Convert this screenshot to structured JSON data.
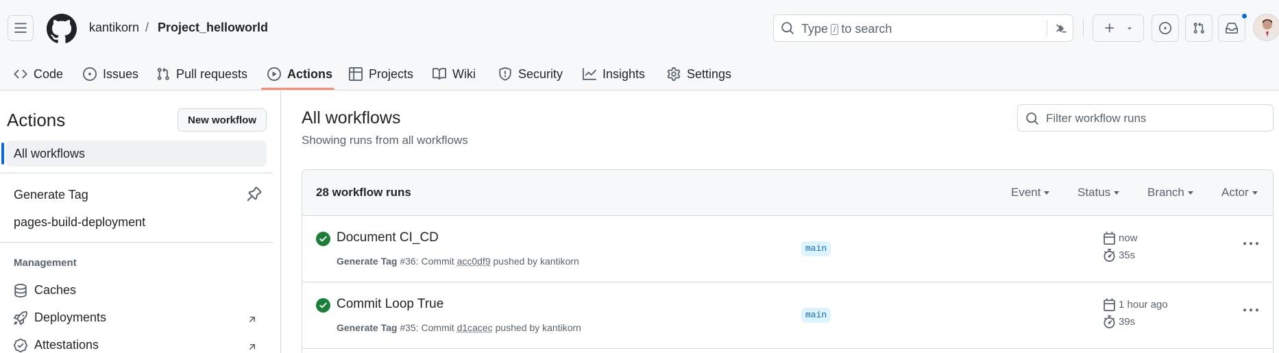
{
  "header": {
    "owner": "kantikorn",
    "separator": "/",
    "repo": "Project_helloworld",
    "search": {
      "prefix": "Type",
      "key": "/",
      "suffix": "to search"
    }
  },
  "repo_nav": [
    {
      "id": "code",
      "label": "Code",
      "icon": "code-icon"
    },
    {
      "id": "issues",
      "label": "Issues",
      "icon": "issue-opened-icon"
    },
    {
      "id": "pulls",
      "label": "Pull requests",
      "icon": "git-pull-request-icon"
    },
    {
      "id": "actions",
      "label": "Actions",
      "icon": "play-icon",
      "active": true
    },
    {
      "id": "projects",
      "label": "Projects",
      "icon": "table-icon"
    },
    {
      "id": "wiki",
      "label": "Wiki",
      "icon": "book-icon"
    },
    {
      "id": "security",
      "label": "Security",
      "icon": "shield-icon"
    },
    {
      "id": "insights",
      "label": "Insights",
      "icon": "graph-icon"
    },
    {
      "id": "settings",
      "label": "Settings",
      "icon": "gear-icon"
    }
  ],
  "sidebar": {
    "title": "Actions",
    "new_workflow": "New workflow",
    "all_workflows": "All workflows",
    "workflows": [
      "Generate Tag",
      "pages-build-deployment"
    ],
    "management_heading": "Management",
    "management": [
      {
        "label": "Caches",
        "icon": "database-icon"
      },
      {
        "label": "Deployments",
        "icon": "rocket-icon",
        "external": true
      },
      {
        "label": "Attestations",
        "icon": "verified-icon",
        "external": true
      }
    ]
  },
  "main": {
    "title": "All workflows",
    "subtitle": "Showing runs from all workflows",
    "filter_placeholder": "Filter workflow runs",
    "runs_count": "28 workflow runs",
    "filters": [
      "Event",
      "Status",
      "Branch",
      "Actor"
    ],
    "runs": [
      {
        "title": "Document CI_CD",
        "workflow": "Generate Tag",
        "detail_prefix": "#36: Commit",
        "sha": "acc0df9",
        "detail_suffix": "pushed by kantikorn",
        "branch": "main",
        "when": "now",
        "duration": "35s",
        "status": "success"
      },
      {
        "title": "Commit Loop True",
        "workflow": "Generate Tag",
        "detail_prefix": "#35: Commit",
        "sha": "d1cacec",
        "detail_suffix": "pushed by kantikorn",
        "branch": "main",
        "when": "1 hour ago",
        "duration": "39s",
        "status": "success"
      }
    ]
  },
  "colors": {
    "accent": "#0969da",
    "success": "#1a7f37",
    "active_tab_underline": "#fd8c73",
    "muted": "#59636e"
  }
}
